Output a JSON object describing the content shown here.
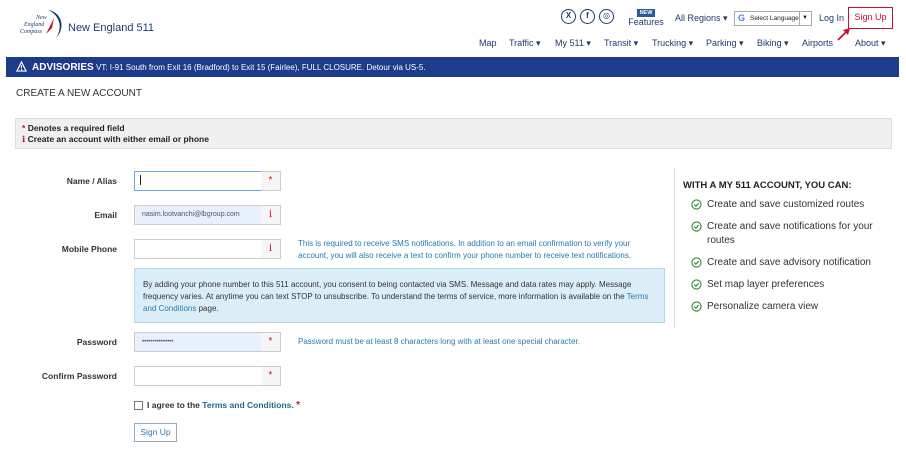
{
  "header": {
    "logo_text": [
      "New",
      "England",
      "Compass"
    ],
    "site_name": "New England 511",
    "social": [
      {
        "icon": "x-icon",
        "glyph": "X"
      },
      {
        "icon": "facebook-icon",
        "glyph": "f"
      },
      {
        "icon": "instagram-icon",
        "glyph": "◎"
      }
    ],
    "features_badge": "NEW",
    "features_label": "Features",
    "regions_label": "All Regions ▾",
    "language_label": "Select Language",
    "language_dropdown": "▼",
    "login_label": "Log In",
    "signup_label": "Sign Up"
  },
  "nav": {
    "items": [
      "Map",
      "Traffic ▾",
      "My 511 ▾",
      "Transit ▾",
      "Trucking ▾",
      "Parking ▾",
      "Biking ▾",
      "Airports",
      "About ▾"
    ]
  },
  "advisory": {
    "title": "ADVISORIES",
    "text": "VT: I-91 South from Exit 16 (Bradford) to Exit 15 (Fairlee), FULL CLOSURE. Detour via US-5."
  },
  "page": {
    "title": "CREATE A NEW ACCOUNT"
  },
  "notice": {
    "required_star": "*",
    "required_text": "Denotes a required field",
    "info_icon": "i",
    "info_text": "Create an account with either email or phone"
  },
  "form": {
    "name_label": "Name / Alias",
    "name_value": "",
    "email_label": "Email",
    "email_value": "nasim.lootvanchi@lbgroup.com",
    "phone_label": "Mobile Phone",
    "phone_value": "",
    "phone_help": "This is required to receive SMS notifications. In addition to an email confirmation to verify your account, you will also receive a text to confirm your phone number to receive text notifications.",
    "sms_text": "By adding your phone number to this 511 account, you consent to being contacted via SMS. Message and data rates may apply. Message frequency varies. At anytime you can text STOP to unsubscribe. To understand the terms of service, more information is available on the",
    "sms_link": "Terms and Conditions",
    "sms_suffix": "page.",
    "password_label": "Password",
    "password_value": "•••••••••••••••",
    "password_help": "Password must be at least 8 characters long with at least one special character.",
    "confirm_label": "Confirm Password",
    "confirm_value": "",
    "required_glyph": "*",
    "info_glyph": "i",
    "agree_prefix": "I agree to the",
    "agree_link": "Terms and Conditions.",
    "agree_star": "*",
    "submit_label": "Sign Up"
  },
  "benefits": {
    "title": "WITH A MY 511 ACCOUNT, YOU CAN:",
    "items": [
      "Create and save customized routes",
      "Create and save notifications for your routes",
      "Create and save advisory notification",
      "Set map layer preferences",
      "Personalize camera view"
    ]
  },
  "colors": {
    "brand": "#1e3a6e",
    "advisory_bg": "#1e3a8a",
    "accent_red": "#c8102e",
    "link_blue": "#2a7ab0",
    "check_green": "#2e8b3a"
  }
}
